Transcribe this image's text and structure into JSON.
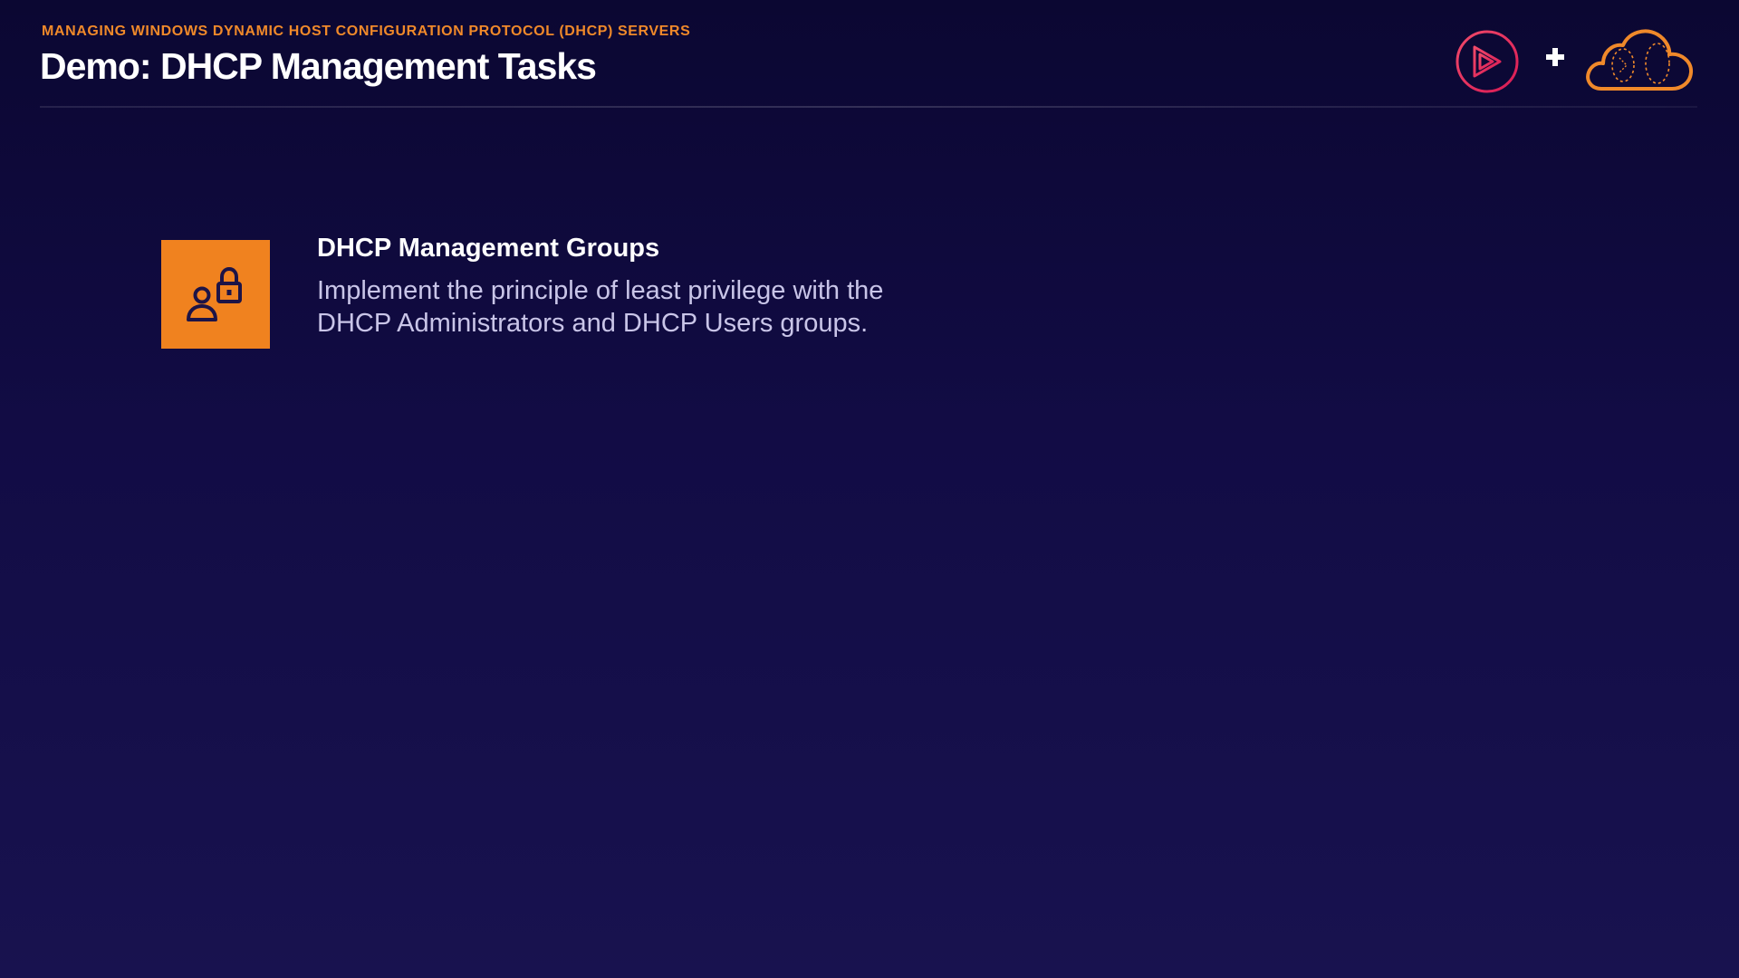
{
  "header": {
    "eyebrow": "MANAGING WINDOWS DYNAMIC HOST CONFIGURATION PROTOCOL (DHCP) SERVERS",
    "title": "Demo: DHCP Management Tasks"
  },
  "logos": {
    "play_logo_icon": "play-logo-icon",
    "plus_icon": "plus-icon",
    "cloud_logo_icon": "cloud-logo-icon"
  },
  "card": {
    "icon": "user-lock-icon",
    "title": "DHCP Management Groups",
    "description": "Implement the principle of least privilege with the DHCP Administrators and DHCP Users groups."
  },
  "colors": {
    "accent_orange": "#f0821f",
    "play_logo": "#e0245e",
    "background_top": "#0b0732",
    "background_bottom": "#18124f"
  }
}
